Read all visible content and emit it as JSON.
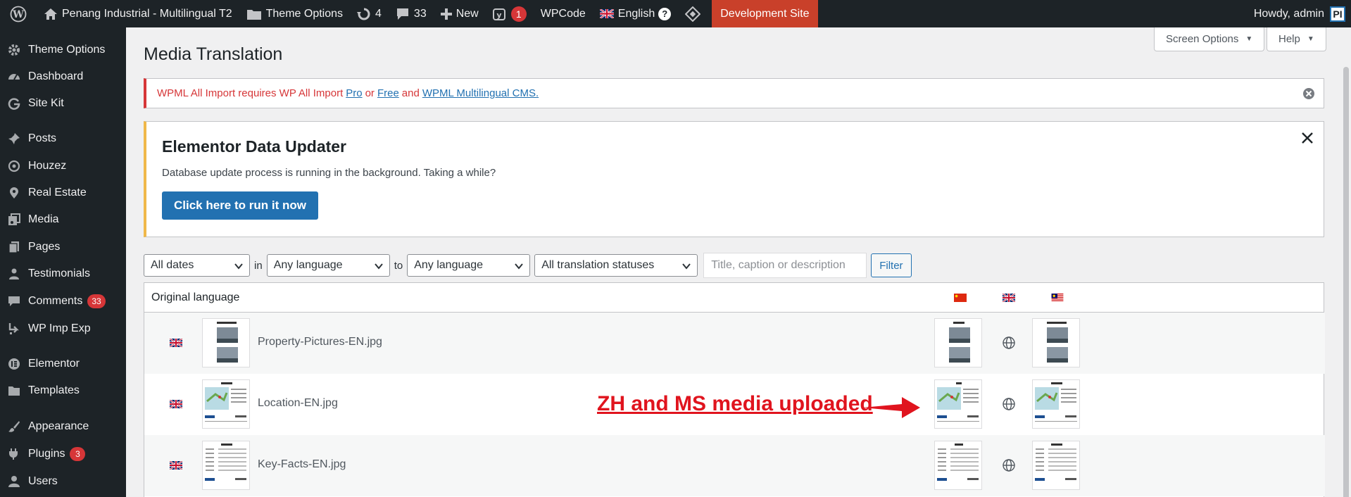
{
  "adminbar": {
    "site_name": "Penang Industrial - Multilingual T2",
    "theme_options": "Theme Options",
    "updates_count": "4",
    "comments_count": "33",
    "new_label": "New",
    "yoast_count": "1",
    "wpcode": "WPCode",
    "language": "English",
    "language_help": "?",
    "dev_site": "Development Site",
    "howdy": "Howdy, admin",
    "avatar_initials": "PI"
  },
  "sidebar": {
    "items": [
      {
        "label": "Theme Options",
        "icon": "gear-icon"
      },
      {
        "label": "Dashboard",
        "icon": "dashboard-icon"
      },
      {
        "label": "Site Kit",
        "icon": "google-g-icon"
      },
      {
        "label": "Posts",
        "icon": "pin-icon"
      },
      {
        "label": "Houzez",
        "icon": "location-icon"
      },
      {
        "label": "Real Estate",
        "icon": "location-icon"
      },
      {
        "label": "Media",
        "icon": "media-icon"
      },
      {
        "label": "Pages",
        "icon": "pages-icon"
      },
      {
        "label": "Testimonials",
        "icon": "users-icon"
      },
      {
        "label": "Comments",
        "icon": "comment-icon",
        "badge": "33"
      },
      {
        "label": "WP Imp Exp",
        "icon": "import-export-icon"
      },
      {
        "label": "Elementor",
        "icon": "elementor-icon"
      },
      {
        "label": "Templates",
        "icon": "folder-icon"
      },
      {
        "label": "Appearance",
        "icon": "paintbrush-icon"
      },
      {
        "label": "Plugins",
        "icon": "plugin-icon",
        "badge": "3"
      },
      {
        "label": "Users",
        "icon": "user-icon"
      }
    ]
  },
  "header": {
    "screen_options": "Screen Options",
    "help": "Help",
    "title": "Media Translation"
  },
  "notice_error": {
    "text_1": "WPML All Import requires WP All Import",
    "link_pro": "Pro",
    "text_or": "or",
    "link_free": "Free",
    "text_and": "and",
    "link_wpml": "WPML Multilingual CMS."
  },
  "notice_elementor": {
    "title": "Elementor Data Updater",
    "message": "Database update process is running in the background. Taking a while?",
    "button": "Click here to run it now"
  },
  "filters": {
    "dates": "All dates",
    "in_word": "in",
    "from_language": "Any language",
    "to_word": "to",
    "to_language": "Any language",
    "status": "All translation statuses",
    "search_placeholder": "Title, caption or description",
    "filter_button": "Filter"
  },
  "table": {
    "header": "Original language",
    "language_columns": [
      "Chinese (flag)",
      "English (flag)",
      "Malay (flag)"
    ],
    "rows": [
      {
        "file": "Property-Pictures-EN.jpg"
      },
      {
        "file": "Location-EN.jpg"
      },
      {
        "file": "Key-Facts-EN.jpg"
      }
    ]
  },
  "annotation": {
    "text": "ZH and MS media uploaded",
    "color": "#e0141e"
  },
  "colors": {
    "adminbar_bg": "#1d2327",
    "dev_site_bg": "#c9402a",
    "primary_button": "#2271b1",
    "error_border": "#d63638",
    "warning_border": "#f0b849"
  }
}
